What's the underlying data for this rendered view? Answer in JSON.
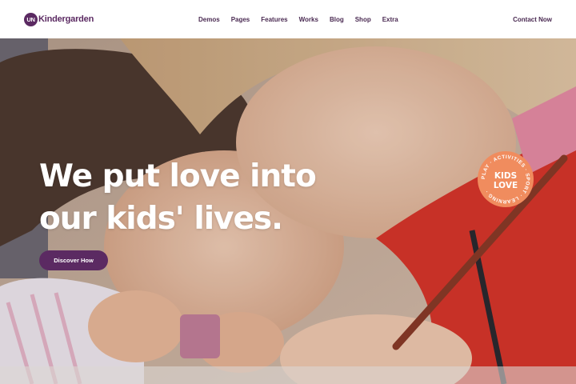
{
  "header": {
    "logo_badge": "UN",
    "logo_text": "Kindergarden",
    "nav": [
      "Demos",
      "Pages",
      "Features",
      "Works",
      "Blog",
      "Shop",
      "Extra"
    ],
    "contact": "Contact Now"
  },
  "hero": {
    "title_line1": "We put love into",
    "title_line2": "our kids' lives.",
    "cta_label": "Discover How",
    "sticker": {
      "line1": "KIDS",
      "line2": "LOVE",
      "ring_text": "PLAY · ACTIVITIES · SPORT · LEARNING ·"
    }
  },
  "colors": {
    "brand_purple": "#5b2a62",
    "sticker_orange": "#f08c5e",
    "white": "#ffffff"
  }
}
